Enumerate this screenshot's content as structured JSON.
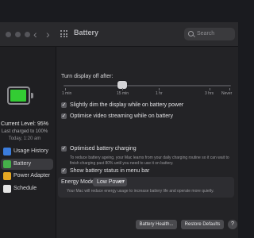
{
  "window": {
    "title": "Battery",
    "search_placeholder": "Search"
  },
  "sidebar": {
    "battery_level_fraction": 0.95,
    "battery_color": "#33cc33",
    "current_level": "Current Level: 95%",
    "last_charged": "Last charged to 100%",
    "last_charged_time": "Today, 1:20 am",
    "items": [
      {
        "label": "Usage History",
        "icon": "usage-history-icon",
        "color": "#3b7ddd"
      },
      {
        "label": "Battery",
        "icon": "battery-icon",
        "color": "#45b04a"
      },
      {
        "label": "Power Adapter",
        "icon": "power-adapter-icon",
        "color": "#e5a823"
      },
      {
        "label": "Schedule",
        "icon": "schedule-icon",
        "color": "#e5e5e5"
      }
    ],
    "active_index": 1
  },
  "main": {
    "turn_off_label": "Turn display off after:",
    "slider_ticks": [
      "1 min",
      "15 min",
      "1 hr",
      "3 hrs",
      "Never"
    ],
    "options": [
      {
        "label": "Slightly dim the display while on battery power",
        "checked": true
      },
      {
        "label": "Optimise video streaming while on battery",
        "checked": true
      },
      {
        "label": "Optimised battery charging",
        "checked": true
      },
      {
        "label": "Show battery status in menu bar",
        "checked": true
      }
    ],
    "optimised_charging_desc": "To reduce battery ageing, your Mac learns from your daily charging routine so it can wait to finish charging past 80% until you need to use it on battery.",
    "energy_mode_label": "Energy Mode:",
    "energy_mode_value": "Low Power",
    "energy_mode_desc": "Your Mac will reduce energy usage to increase battery life and operate more quietly."
  },
  "buttons": {
    "battery_health": "Battery Health...",
    "restore_defaults": "Restore Defaults",
    "help": "?"
  }
}
